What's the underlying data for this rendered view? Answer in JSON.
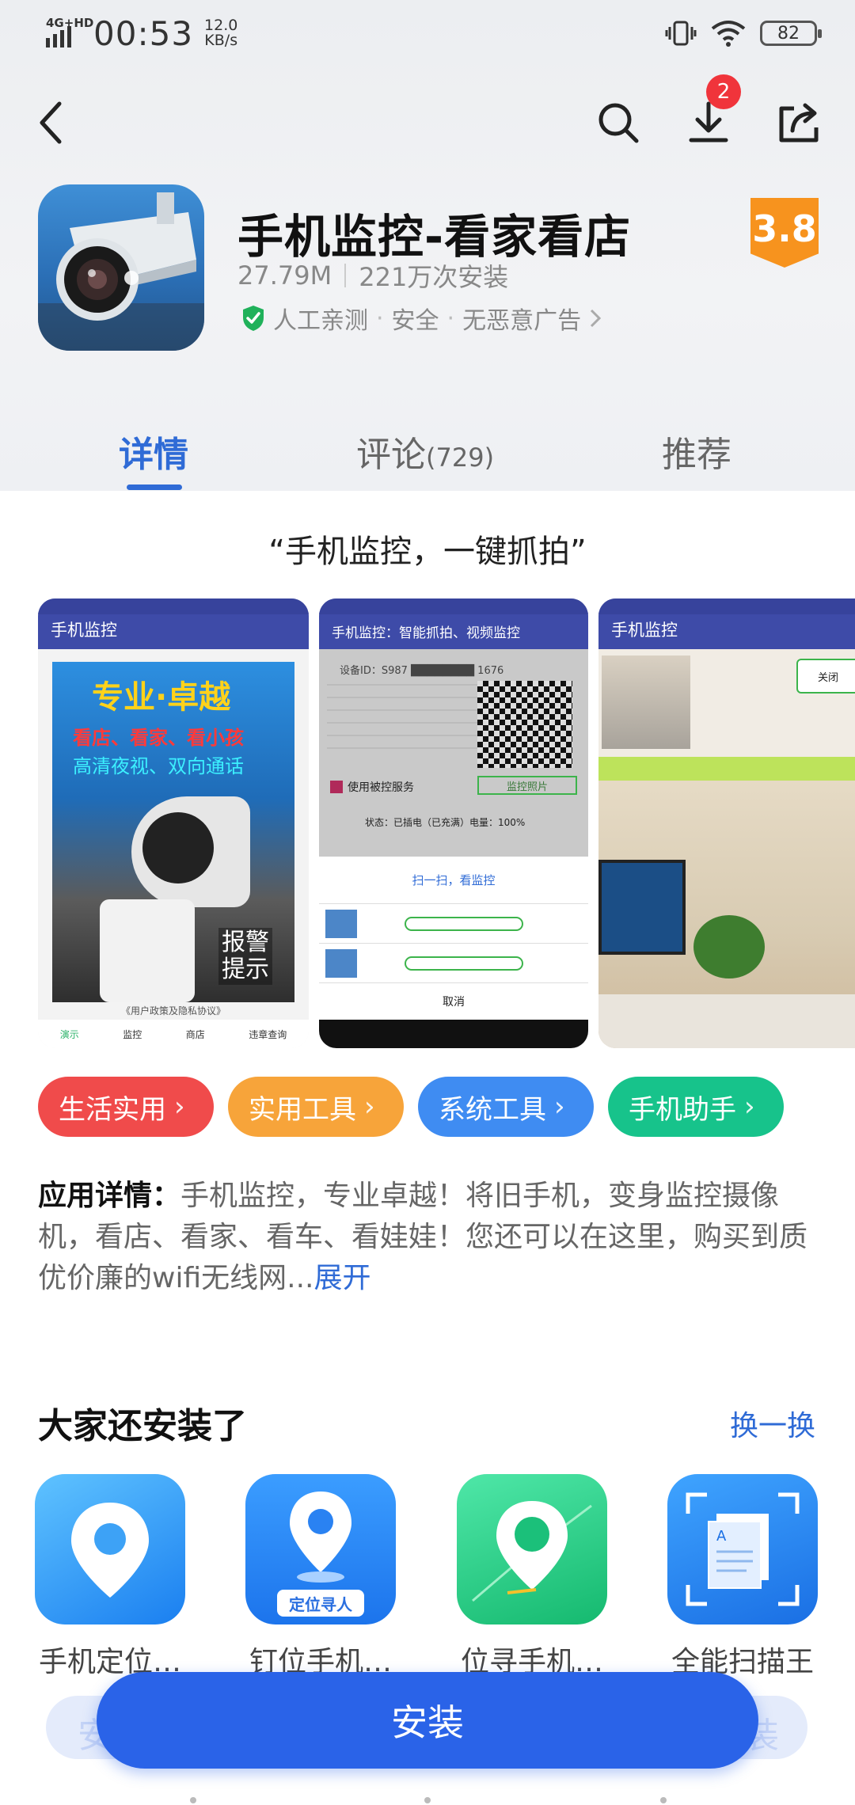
{
  "status_bar": {
    "network": "4G+HD",
    "time": "00:53",
    "speed_value": "12.0",
    "speed_unit": "KB/s",
    "battery": "82"
  },
  "nav": {
    "download_badge": "2"
  },
  "app": {
    "title": "手机监控-看家看店",
    "size": "27.79M",
    "installs": "221万次安装",
    "tags": [
      "人工亲测",
      "安全",
      "无恶意广告"
    ],
    "rating": "3.8"
  },
  "tabs": [
    {
      "label": "详情"
    },
    {
      "label": "评论",
      "count": "(729)"
    },
    {
      "label": "推荐"
    }
  ],
  "slogan": "“手机监控，一键抓拍”",
  "screenshots": [
    {
      "bar_title": "手机监控",
      "lines": [
        "专业·卓越",
        "看店、看家、看小孩",
        "高清夜视、双向通话",
        "报警",
        "提示",
        "《用户政策及隐私协议》"
      ],
      "tabs": [
        "演示",
        "监控",
        "商店",
        "违章查询"
      ]
    },
    {
      "bar_title": "手机监控：智能抓拍、视频监控",
      "lines": [
        "设备ID：S987",
        "1676",
        "使用被控服务",
        "监控照片",
        "状态：已插电（已充满）电量：100%",
        "扫一扫，看监控",
        "取消"
      ]
    },
    {
      "bar_title": "手机监控",
      "lines": [
        "关闭"
      ]
    }
  ],
  "categories": [
    {
      "label": "生活实用",
      "color": "#f04b4b"
    },
    {
      "label": "实用工具",
      "color": "#f7a43a"
    },
    {
      "label": "系统工具",
      "color": "#3f8cf2"
    },
    {
      "label": "手机助手",
      "color": "#17c38b"
    }
  ],
  "details": {
    "label": "应用详情：",
    "text": "手机监控，专业卓越！将旧手机，变身监控摄像机，看店、看家、看车、看娃娃！您还可以在这里，购买到质优价廉的wifi无线网...",
    "more": "展开"
  },
  "also_installed": {
    "title": "大家还安装了",
    "refresh": "换一换",
    "apps": [
      {
        "name": "手机定位…",
        "icon": "location-pin-icon"
      },
      {
        "name": "钉位手机…",
        "icon": "locate-person-icon",
        "caption": "定位寻人"
      },
      {
        "name": "位寻手机…",
        "icon": "map-route-icon"
      },
      {
        "name": "全能扫描王",
        "icon": "scan-document-icon"
      }
    ]
  },
  "install": {
    "label": "安装",
    "behind_left": "安",
    "behind_right": "装"
  }
}
